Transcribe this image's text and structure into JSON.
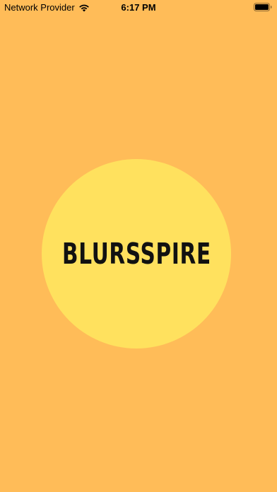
{
  "status_bar": {
    "carrier": "Network Provider",
    "time": "6:17 PM",
    "wifi_icon": "wifi-icon",
    "battery_icon": "battery-icon"
  },
  "splash": {
    "brand_text": "BLURSSPIRE"
  },
  "colors": {
    "background": "#FFBC58",
    "circle": "#FFE15E",
    "text": "#111111"
  }
}
